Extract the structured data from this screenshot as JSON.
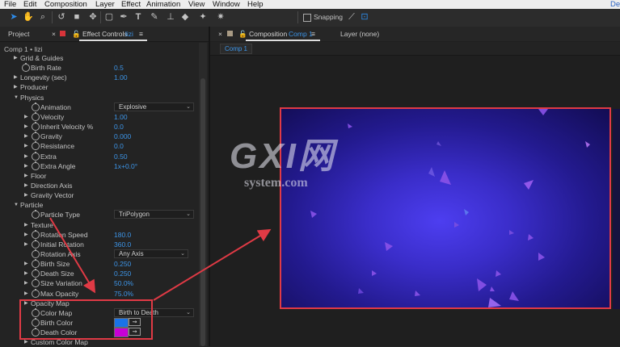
{
  "menu": [
    "File",
    "Edit",
    "Composition",
    "Layer",
    "Effect",
    "Animation",
    "View",
    "Window",
    "Help"
  ],
  "menu_right": "De",
  "toolbar": {
    "snapping_label": "Snapping"
  },
  "left_panel": {
    "project_tab": "Project",
    "effect_controls_tab": "Effect Controls",
    "effect_controls_layer": "lizi",
    "comp_title": "Comp 1 • lizi"
  },
  "properties": [
    {
      "label": "Grid & Guides",
      "indent": 1,
      "tri": true,
      "stopwatch": false
    },
    {
      "label": "Birth Rate",
      "indent": 1,
      "tri": false,
      "stopwatch": true,
      "value": "0.5"
    },
    {
      "label": "Longevity (sec)",
      "indent": 1,
      "tri": true,
      "stopwatch": false,
      "value": "1.00"
    },
    {
      "label": "Producer",
      "indent": 1,
      "tri": true,
      "stopwatch": false
    },
    {
      "label": "Physics",
      "indent": 1,
      "tri": true,
      "open": true,
      "stopwatch": false
    },
    {
      "label": "Animation",
      "indent": 2,
      "tri": false,
      "stopwatch": true,
      "dropdown": "Explosive"
    },
    {
      "label": "Velocity",
      "indent": 2,
      "tri": true,
      "stopwatch": true,
      "value": "1.00"
    },
    {
      "label": "Inherit Velocity %",
      "indent": 2,
      "tri": true,
      "stopwatch": true,
      "value": "0.0"
    },
    {
      "label": "Gravity",
      "indent": 2,
      "tri": true,
      "stopwatch": true,
      "value": "0.000"
    },
    {
      "label": "Resistance",
      "indent": 2,
      "tri": true,
      "stopwatch": true,
      "value": "0.0"
    },
    {
      "label": "Extra",
      "indent": 2,
      "tri": true,
      "stopwatch": true,
      "value": "0.50"
    },
    {
      "label": "Extra Angle",
      "indent": 2,
      "tri": true,
      "stopwatch": true,
      "value": "1x+0.0°"
    },
    {
      "label": "Floor",
      "indent": 2,
      "tri": true,
      "stopwatch": false
    },
    {
      "label": "Direction Axis",
      "indent": 2,
      "tri": true,
      "stopwatch": false
    },
    {
      "label": "Gravity Vector",
      "indent": 2,
      "tri": true,
      "stopwatch": false
    },
    {
      "label": "Particle",
      "indent": 1,
      "tri": true,
      "open": true,
      "stopwatch": false
    },
    {
      "label": "Particle Type",
      "indent": 2,
      "tri": false,
      "stopwatch": true,
      "dropdown": "TriPolygon"
    },
    {
      "label": "Texture",
      "indent": 2,
      "tri": true,
      "stopwatch": false
    },
    {
      "label": "Rotation Speed",
      "indent": 2,
      "tri": true,
      "stopwatch": true,
      "value": "180.0"
    },
    {
      "label": "Initial Rotation",
      "indent": 2,
      "tri": true,
      "stopwatch": true,
      "value": "360.0"
    },
    {
      "label": "Rotation Axis",
      "indent": 2,
      "tri": false,
      "stopwatch": true,
      "dropdown": "Any Axis",
      "dropdown_short": true
    },
    {
      "label": "Birth Size",
      "indent": 2,
      "tri": true,
      "stopwatch": true,
      "value": "0.250"
    },
    {
      "label": "Death Size",
      "indent": 2,
      "tri": true,
      "stopwatch": true,
      "value": "0.250"
    },
    {
      "label": "Size Variation",
      "indent": 2,
      "tri": true,
      "stopwatch": true,
      "value": "50.0%"
    },
    {
      "label": "Max Opacity",
      "indent": 2,
      "tri": true,
      "stopwatch": true,
      "value": "75.0%"
    },
    {
      "label": "Opacity Map",
      "indent": 2,
      "tri": true,
      "stopwatch": false
    },
    {
      "label": "Color Map",
      "indent": 2,
      "tri": false,
      "stopwatch": true,
      "dropdown": "Birth to Death"
    },
    {
      "label": "Birth Color",
      "indent": 2,
      "tri": false,
      "stopwatch": true,
      "color": "#1a73e8"
    },
    {
      "label": "Death Color",
      "indent": 2,
      "tri": false,
      "stopwatch": true,
      "color": "#c800d6"
    },
    {
      "label": "Custom Color Map",
      "indent": 2,
      "tri": true,
      "stopwatch": false
    }
  ],
  "right_panel": {
    "composition_tab": "Composition",
    "comp_name": "Comp 1",
    "layer_tab": "Layer (none)",
    "comp_subtab": "Comp 1"
  },
  "watermark": {
    "logo_text": "GXI网",
    "sub_text": "system.com"
  },
  "colors": {
    "accent": "#2d8ceb",
    "annotation_red": "#e03a45",
    "canvas_center": "#4d3ef0",
    "canvas_edge": "#120c52"
  }
}
